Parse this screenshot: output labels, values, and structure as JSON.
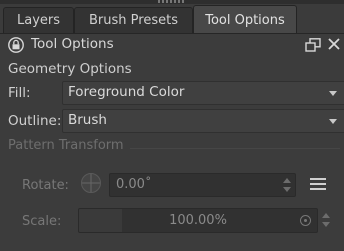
{
  "tabs": [
    {
      "label": "Layers",
      "active": false
    },
    {
      "label": "Brush Presets",
      "active": false
    },
    {
      "label": "Tool Options",
      "active": true
    }
  ],
  "panel": {
    "title": "Tool Options",
    "icons": {
      "lock": "lock-icon",
      "float": "float-icon",
      "close": "close-icon"
    }
  },
  "geometry": {
    "section_label": "Geometry Options",
    "fill": {
      "label": "Fill:",
      "value": "Foreground Color"
    },
    "outline": {
      "label": "Outline:",
      "value": "Brush"
    }
  },
  "pattern": {
    "group_title": "Pattern Transform",
    "enabled": false,
    "rotate": {
      "label": "Rotate:",
      "value": "0.00˚"
    },
    "scale": {
      "label": "Scale:",
      "value": "100.00%",
      "fraction": 0.18
    }
  },
  "colors": {
    "background": "#3c3c3c",
    "text": "#d8d8d8",
    "disabled_text": "#777777"
  }
}
